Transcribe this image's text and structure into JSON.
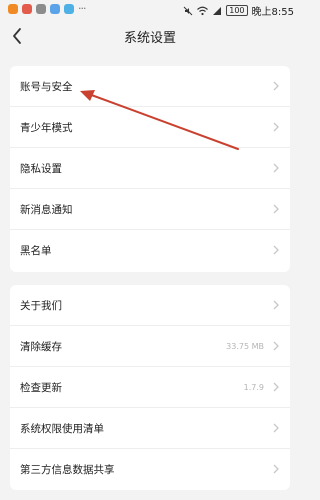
{
  "status_bar": {
    "time": "晚上8:55",
    "battery": "100",
    "app_icon_colors": [
      "#f08a24",
      "#e35b4a",
      "#8c8c8c",
      "#5aa3e8",
      "#4fb0e6"
    ]
  },
  "header": {
    "title": "系统设置",
    "back_icon": "chevron-left-icon"
  },
  "settings_group_1": [
    {
      "label": "账号与安全"
    },
    {
      "label": "青少年模式"
    },
    {
      "label": "隐私设置"
    },
    {
      "label": "新消息通知"
    },
    {
      "label": "黑名单"
    }
  ],
  "settings_group_2": [
    {
      "label": "关于我们",
      "value": ""
    },
    {
      "label": "清除缓存",
      "value": "33.75 MB"
    },
    {
      "label": "检查更新",
      "value": "1.7.9"
    },
    {
      "label": "系统权限使用清单",
      "value": ""
    },
    {
      "label": "第三方信息数据共享",
      "value": ""
    }
  ],
  "annotation": {
    "type": "arrow",
    "color": "#c9412f",
    "points_to": "账号与安全"
  }
}
